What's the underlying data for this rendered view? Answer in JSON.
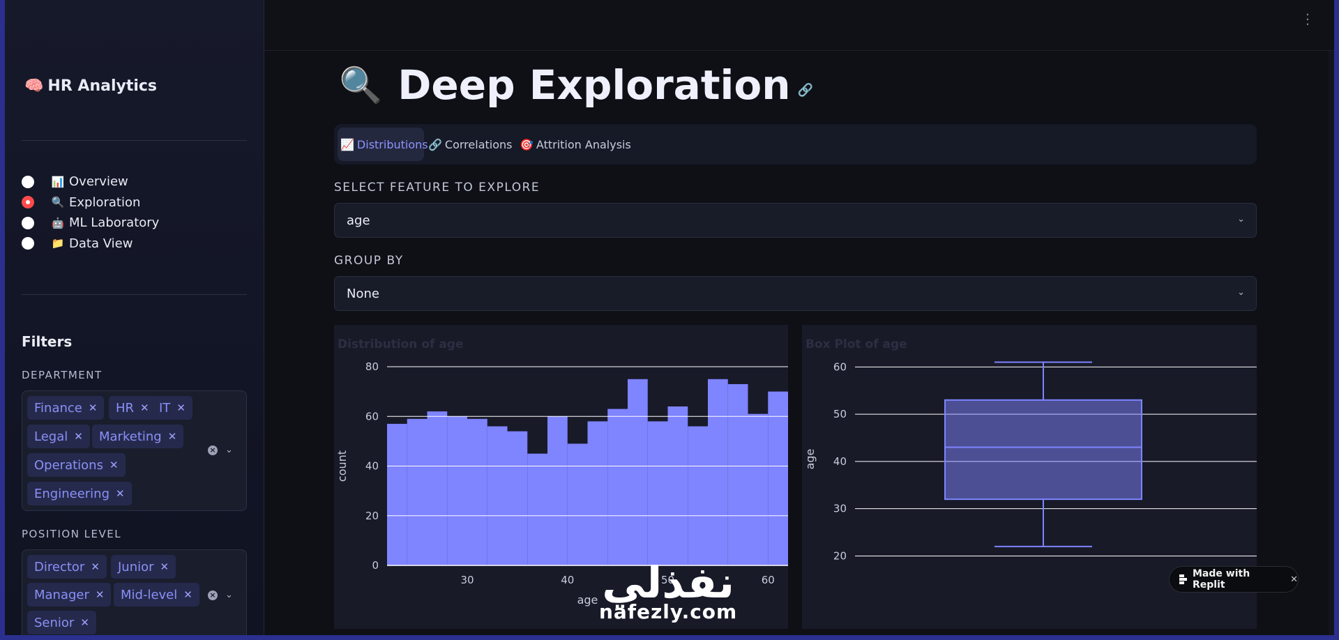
{
  "sidebar": {
    "brand": "HR Analytics",
    "nav": [
      {
        "icon": "📊",
        "label": "Overview",
        "selected": false
      },
      {
        "icon": "🔍",
        "label": "Exploration",
        "selected": true
      },
      {
        "icon": "🤖",
        "label": "ML Laboratory",
        "selected": false
      },
      {
        "icon": "📁",
        "label": "Data View",
        "selected": false
      }
    ],
    "filters_title": "Filters",
    "department": {
      "label": "DEPARTMENT",
      "chips": [
        "Finance",
        "HR",
        "IT",
        "Legal",
        "Marketing",
        "Operations",
        "Engineering"
      ]
    },
    "position_level": {
      "label": "POSITION LEVEL",
      "chips": [
        "Director",
        "Junior",
        "Manager",
        "Mid-level",
        "Senior"
      ]
    }
  },
  "page": {
    "title": "Deep Exploration",
    "tabs": [
      {
        "icon": "📈",
        "label": "Distributions",
        "active": true
      },
      {
        "icon": "🔗",
        "label": "Correlations",
        "active": false
      },
      {
        "icon": "🎯",
        "label": "Attrition Analysis",
        "active": false
      }
    ],
    "feature_select": {
      "label": "SELECT FEATURE TO EXPLORE",
      "value": "age"
    },
    "group_select": {
      "label": "GROUP BY",
      "value": "None"
    }
  },
  "chart_data": [
    {
      "type": "bar",
      "title": "Distribution of age",
      "xlabel": "age",
      "ylabel": "count",
      "x_range": [
        22,
        62
      ],
      "ylim": [
        0,
        80
      ],
      "x_ticks": [
        30,
        40,
        50,
        60
      ],
      "y_ticks": [
        0,
        20,
        40,
        60,
        80
      ],
      "bin_start": 22,
      "bin_width": 2,
      "values": [
        57,
        59,
        62,
        60,
        59,
        56,
        54,
        45,
        60,
        49,
        58,
        63,
        75,
        58,
        64,
        56,
        75,
        73,
        61,
        70
      ],
      "color": "#7f84ff"
    },
    {
      "type": "box",
      "title": "Box Plot of age",
      "ylabel": "age",
      "ylim": [
        18,
        63
      ],
      "y_ticks": [
        20,
        30,
        40,
        50,
        60
      ],
      "min": 22,
      "q1": 32,
      "median": 43,
      "q3": 53,
      "max": 61,
      "color": "#7f84ff"
    }
  ],
  "badge": {
    "label": "Made with Replit"
  },
  "watermark": {
    "arabic": "نفذلي",
    "latin": "nafezly.com"
  }
}
